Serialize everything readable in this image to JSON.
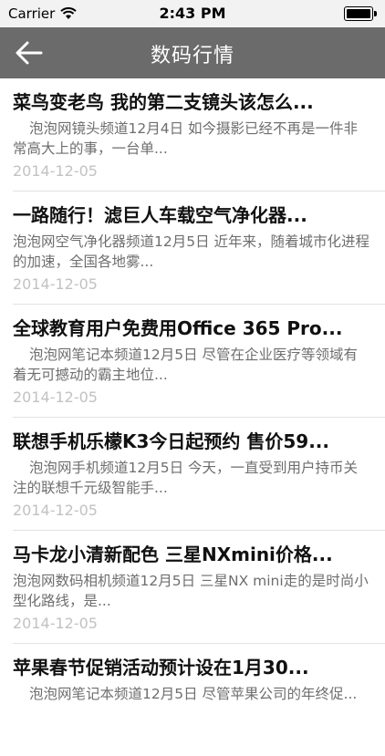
{
  "status_bar": {
    "carrier": "Carrier",
    "time": "2:43 PM"
  },
  "nav": {
    "title": "数码行情"
  },
  "news": [
    {
      "title": "菜鸟变老鸟 我的第二支镜头该怎么...",
      "summary": "泡泡网镜头频道12月4日 如今摄影已经不再是一件非常高大上的事，一台单...",
      "date": "2014-12-05"
    },
    {
      "title": "一路随行！滤巨人车载空气净化器...",
      "summary": "泡泡网空气净化器频道12月5日 近年来，随着城市化进程的加速，全国各地雾...",
      "date": "2014-12-05"
    },
    {
      "title": "全球教育用户免费用Office 365 Pro...",
      "summary": "泡泡网笔记本频道12月5日 尽管在企业医疗等领域有着无可撼动的霸主地位...",
      "date": "2014-12-05"
    },
    {
      "title": "联想手机乐檬K3今日起预约 售价59...",
      "summary": "泡泡网手机频道12月5日 今天，一直受到用户持币关注的联想千元级智能手...",
      "date": "2014-12-05"
    },
    {
      "title": "马卡龙小清新配色 三星NXmini价格...",
      "summary": "泡泡网数码相机频道12月5日 三星NX mini走的是时尚小型化路线，是...",
      "date": "2014-12-05"
    },
    {
      "title": "苹果春节促销活动预计设在1月30...",
      "summary": "泡泡网笔记本频道12月5日 尽管苹果公司的年终促...",
      "date": ""
    }
  ]
}
